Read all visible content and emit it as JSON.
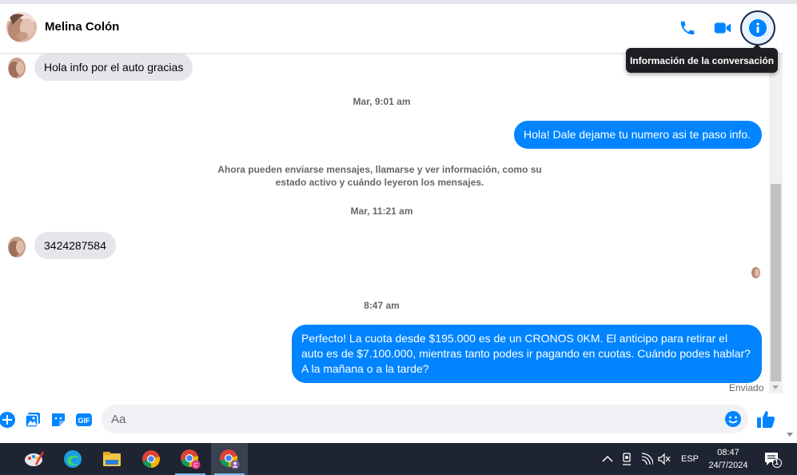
{
  "contact": {
    "name": "Melina Colón"
  },
  "header": {
    "info_tooltip": "Información de la conversación"
  },
  "messages": {
    "m1_in": "Hola info por el auto gracias",
    "ts1": "Mar, 9:01 am",
    "m2_out": "Hola! Dale dejame tu numero  asi te paso info.",
    "system_note": "Ahora pueden enviarse mensajes, llamarse y ver información, como su estado activo y cuándo leyeron los mensajes.",
    "ts2": "Mar, 11:21 am",
    "m3_in": "3424287584",
    "ts3": "8:47 am",
    "m4_out": "Perfecto! La cuota desde $195.000 es de un CRONOS 0KM. El anticipo para retirar el auto es de $7.100.000, mientras tanto podes ir pagando en cuotas. Cuándo podes hablar? A la mañana o a la tarde?",
    "status": "Enviado"
  },
  "composer": {
    "placeholder": "Aa"
  },
  "taskbar": {
    "language": "ESP",
    "time": "08:47",
    "date": "24/7/2024",
    "notification_count": "1"
  },
  "colors": {
    "accent": "#0084ff",
    "incoming_bubble": "#e4e6eb",
    "taskbar": "#1e2432"
  }
}
